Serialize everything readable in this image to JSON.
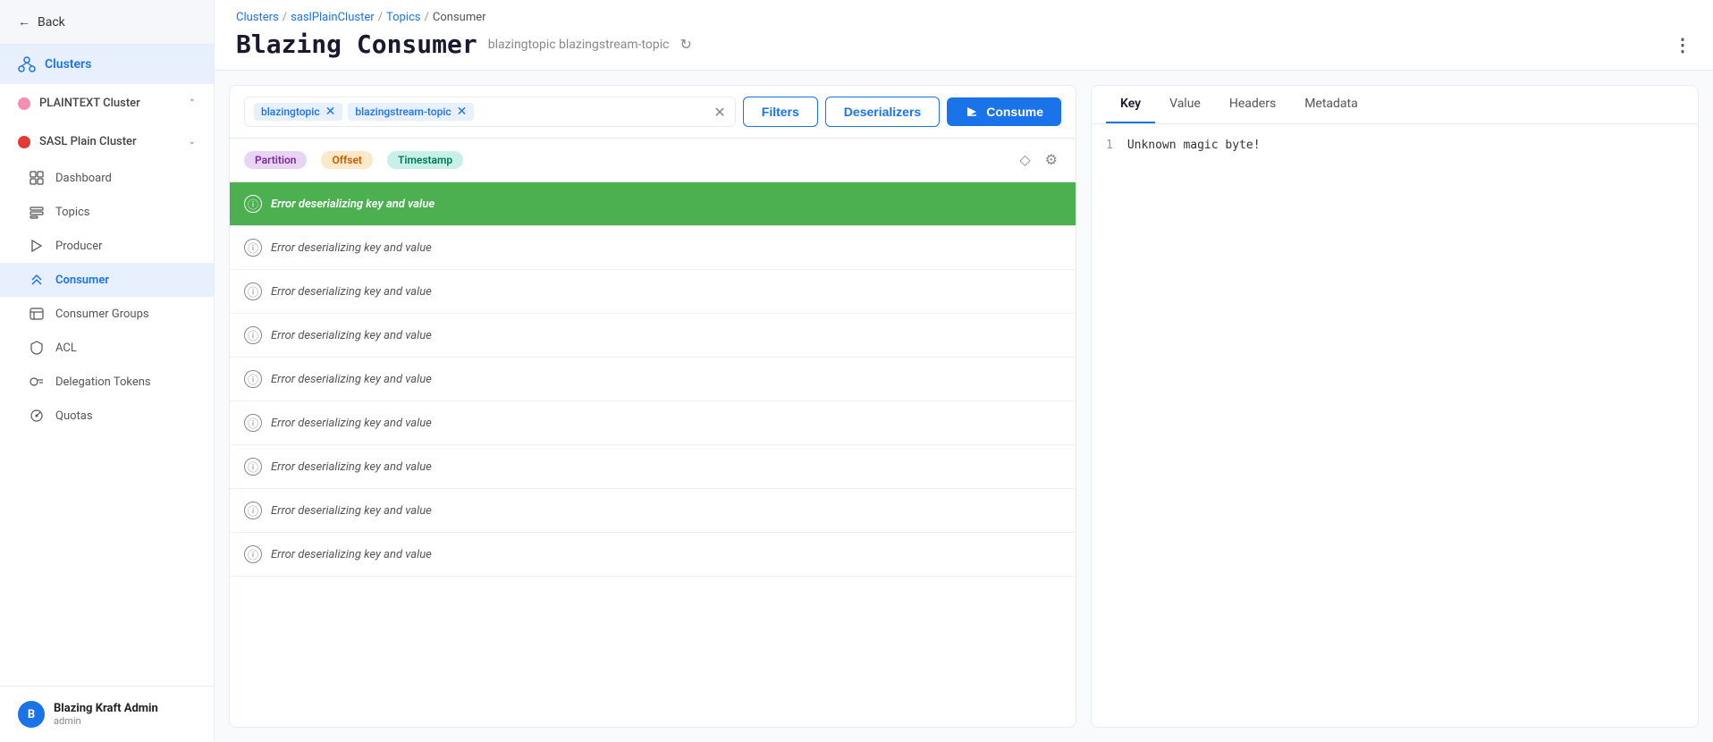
{
  "sidebar": {
    "back_label": "Back",
    "clusters_label": "Clusters",
    "plaintext_cluster": {
      "name": "PLAINTEXT Cluster",
      "dot_color": "pink"
    },
    "sasl_cluster": {
      "name": "SASL Plain Cluster",
      "dot_color": "red"
    },
    "nav_items": [
      {
        "id": "dashboard",
        "label": "Dashboard",
        "icon": "dashboard"
      },
      {
        "id": "topics",
        "label": "Topics",
        "icon": "topics"
      },
      {
        "id": "producer",
        "label": "Producer",
        "icon": "producer"
      },
      {
        "id": "consumer",
        "label": "Consumer",
        "icon": "consumer",
        "active": true
      },
      {
        "id": "consumer-groups",
        "label": "Consumer Groups",
        "icon": "consumer-groups"
      },
      {
        "id": "acl",
        "label": "ACL",
        "icon": "acl"
      },
      {
        "id": "delegation-tokens",
        "label": "Delegation Tokens",
        "icon": "delegation-tokens"
      },
      {
        "id": "quotas",
        "label": "Quotas",
        "icon": "quotas"
      }
    ],
    "user": {
      "avatar_letter": "B",
      "name": "Blazing Kraft Admin",
      "role": "admin"
    }
  },
  "breadcrumb": {
    "clusters": "Clusters",
    "cluster": "saslPlainCluster",
    "topics": "Topics",
    "current": "Consumer"
  },
  "header": {
    "title": "Blazing Consumer",
    "subtitle": "blazingtopic  blazingstream-topic"
  },
  "filter_bar": {
    "tags": [
      "blazingtopic",
      "blazingstream-topic"
    ],
    "filters_btn": "Filters",
    "deserializers_btn": "Deserializers",
    "consume_btn": "Consume"
  },
  "columns": {
    "partition": "Partition",
    "offset": "Offset",
    "timestamp": "Timestamp"
  },
  "messages": [
    {
      "id": 1,
      "text": "Error deserializing key and value",
      "selected": true
    },
    {
      "id": 2,
      "text": "Error deserializing key and value",
      "selected": false
    },
    {
      "id": 3,
      "text": "Error deserializing key and value",
      "selected": false
    },
    {
      "id": 4,
      "text": "Error deserializing key and value",
      "selected": false
    },
    {
      "id": 5,
      "text": "Error deserializing key and value",
      "selected": false
    },
    {
      "id": 6,
      "text": "Error deserializing key and value",
      "selected": false
    },
    {
      "id": 7,
      "text": "Error deserializing key and value",
      "selected": false
    },
    {
      "id": 8,
      "text": "Error deserializing key and value",
      "selected": false
    },
    {
      "id": 9,
      "text": "Error deserializing key and value",
      "selected": false
    }
  ],
  "right_panel": {
    "tabs": [
      "Key",
      "Value",
      "Headers",
      "Metadata"
    ],
    "active_tab": "Key",
    "content_line": "Unknown magic byte!"
  }
}
